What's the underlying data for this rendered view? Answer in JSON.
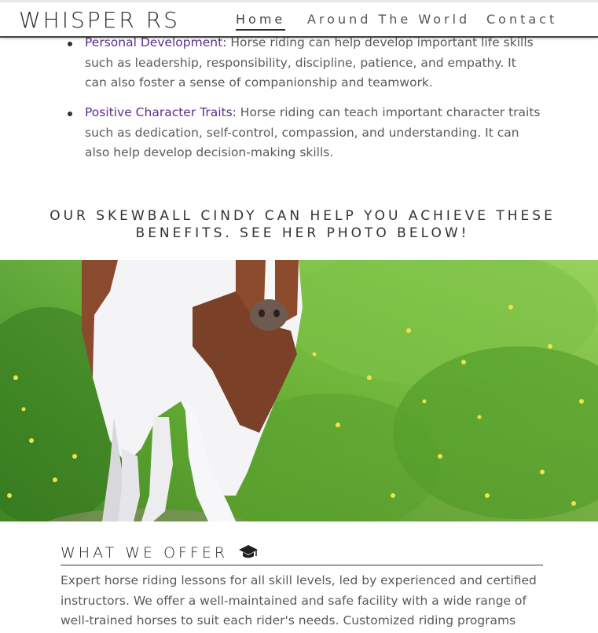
{
  "header": {
    "brand": "WHISPER RS",
    "nav": {
      "home": "Home",
      "world": "Around The World",
      "contact": "Contact"
    }
  },
  "benefits": [
    {
      "term": "Personal Development:",
      "text": " Horse riding can help develop important life skills such as leadership, responsibility, discipline, patience, and empathy. It can also foster a sense of companionship and teamwork."
    },
    {
      "term": "Positive Character Traits:",
      "text": " Horse riding can teach important character traits such as dedication, self-control, compassion, and understanding. It can also help develop decision-making skills."
    }
  ],
  "cindy_heading": "OUR SKEWBALL CINDY CAN HELP YOU ACHIEVE THESE BENEFITS. SEE HER PHOTO BELOW!",
  "offer": {
    "title": "WHAT WE OFFER",
    "icon": "graduation-cap-icon",
    "text": "Expert horse riding lessons for all skill levels, led by experienced and certified instructors. We offer a well-maintained and safe facility with a wide range of well-trained horses to suit each rider's needs. Customized riding programs tailored to"
  },
  "colors": {
    "accent_term": "#5a2e8c",
    "grass": "#6aa832"
  }
}
